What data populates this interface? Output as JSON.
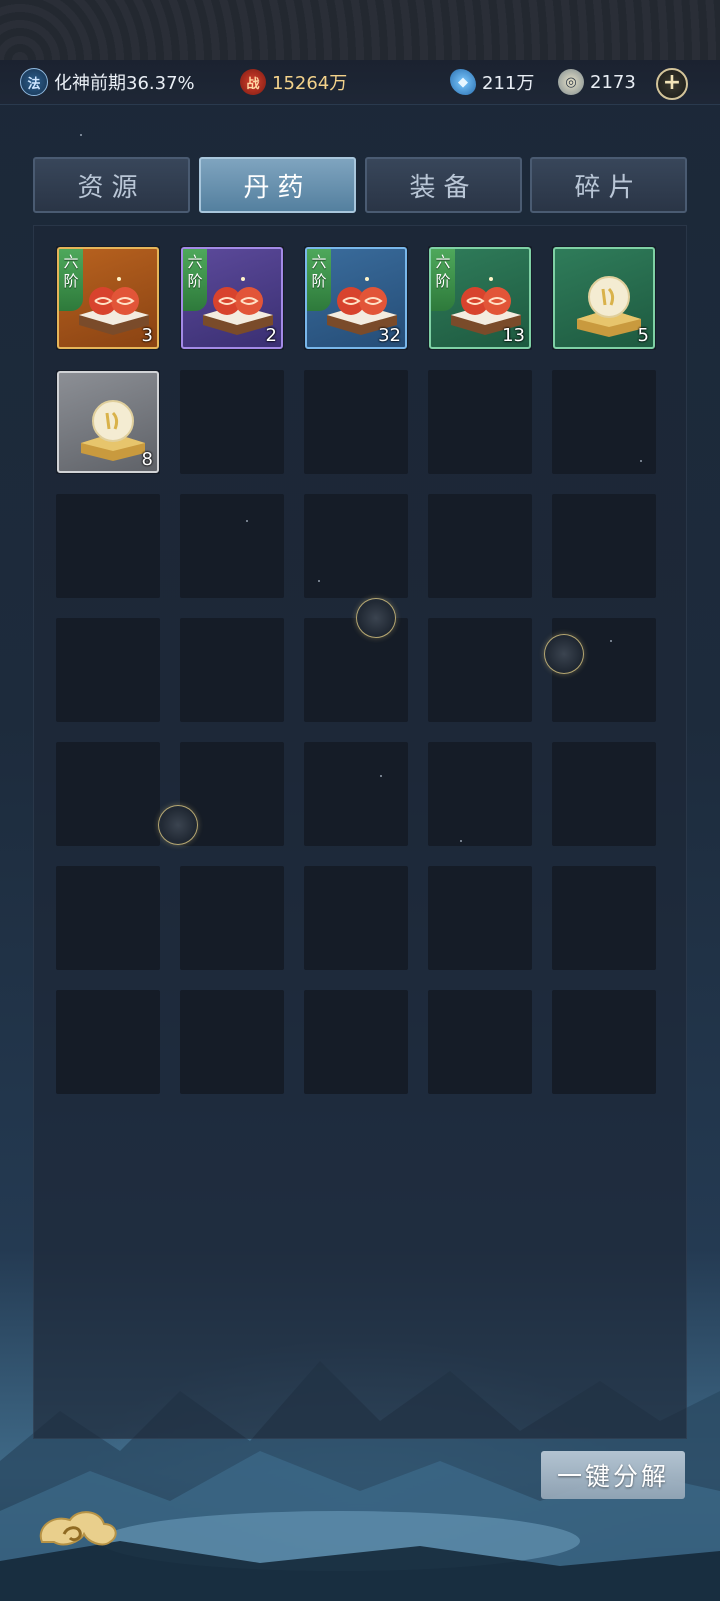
{
  "status": {
    "realm_icon": "法",
    "realm_text": "化神前期36.37%",
    "power_icon": "战",
    "power_value": "15264万",
    "crystal_value": "211万",
    "spirit_value": "2173",
    "plus_label": "+"
  },
  "tabs": [
    {
      "label": "资源",
      "active": false
    },
    {
      "label": "丹药",
      "active": true
    },
    {
      "label": "装备",
      "active": false
    },
    {
      "label": "碎片",
      "active": false
    }
  ],
  "items": [
    {
      "type": "pill-pair",
      "quality": "orange",
      "tier": "六阶",
      "count": "3"
    },
    {
      "type": "pill-pair",
      "quality": "purple",
      "tier": "六阶",
      "count": "2"
    },
    {
      "type": "pill-pair",
      "quality": "blue",
      "tier": "六阶",
      "count": "32"
    },
    {
      "type": "pill-pair",
      "quality": "green",
      "tier": "六阶",
      "count": "13"
    },
    {
      "type": "pearl",
      "quality": "green",
      "tier": "",
      "count": "5"
    },
    {
      "type": "pearl",
      "quality": "gray",
      "tier": "",
      "count": "8"
    }
  ],
  "grid": {
    "columns": 5,
    "rows": 7
  },
  "actions": {
    "decompose_label": "一键分解"
  },
  "icons": {
    "realm": "realm-seal-icon",
    "power": "battle-power-icon",
    "crystal": "spirit-crystal-icon",
    "spirit": "spirit-stone-icon",
    "back": "cloud-back-icon"
  },
  "colors": {
    "power_text": "#f3d28b",
    "tab_active": "#6f96b3"
  }
}
